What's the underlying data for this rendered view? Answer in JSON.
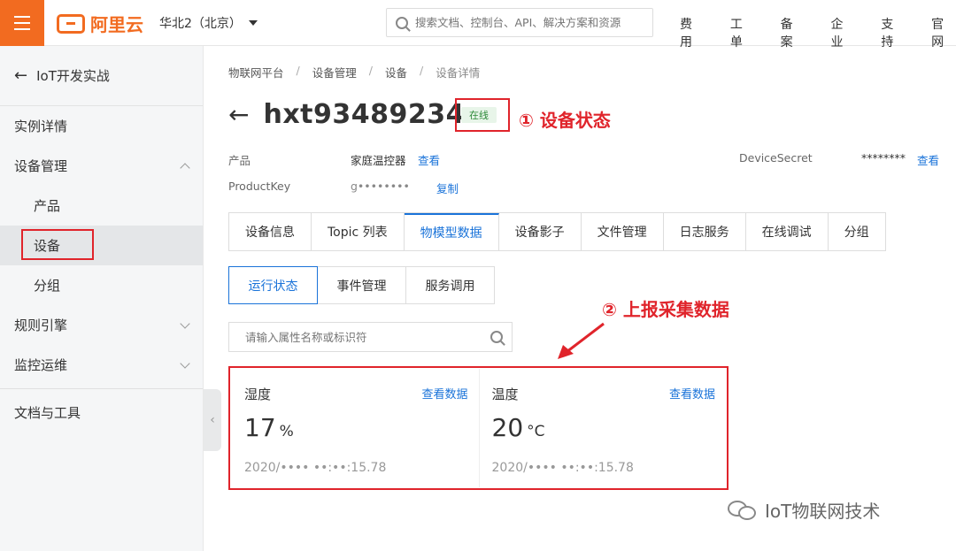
{
  "topbar": {
    "logo_text": "阿里云",
    "region": "华北2（北京）",
    "search_placeholder": "搜索文档、控制台、API、解决方案和资源",
    "nav": [
      "费用",
      "工单",
      "备案",
      "企业",
      "支持",
      "官网"
    ]
  },
  "sidebar": {
    "title": "IoT开发实战",
    "items": [
      {
        "label": "实例详情"
      },
      {
        "label": "设备管理"
      },
      {
        "label": "产品"
      },
      {
        "label": "设备"
      },
      {
        "label": "分组"
      },
      {
        "label": "规则引擎"
      },
      {
        "label": "监控运维"
      },
      {
        "label": "文档与工具"
      }
    ]
  },
  "breadcrumb": [
    "物联网平台",
    "设备管理",
    "设备",
    "设备详情"
  ],
  "device": {
    "name": "hxt93489234",
    "status": "在线",
    "product_label": "产品",
    "product_value": "家庭温控器",
    "product_link": "查看",
    "productkey_label": "ProductKey",
    "productkey_value": "g••••••••",
    "productkey_link": "复制",
    "secret_label": "DeviceSecret",
    "secret_value": "********",
    "secret_link": "查看"
  },
  "annotations": {
    "status": "① 设备状态",
    "data": "② 上报采集数据"
  },
  "tabs": [
    "设备信息",
    "Topic 列表",
    "物模型数据",
    "设备影子",
    "文件管理",
    "日志服务",
    "在线调试",
    "分组"
  ],
  "subtabs": [
    "运行状态",
    "事件管理",
    "服务调用"
  ],
  "prop_search_placeholder": "请输入属性名称或标识符",
  "cards": [
    {
      "label": "湿度",
      "link": "查看数据",
      "value": "17",
      "unit": "%",
      "time": "2020/•••• ••:••:15.78"
    },
    {
      "label": "温度",
      "link": "查看数据",
      "value": "20",
      "unit": "°C",
      "time": "2020/•••• ••:••:15.78"
    }
  ],
  "watermark": "IoT物联网技术",
  "colors": {
    "brand": "#f26b20",
    "link": "#1a73d9",
    "annotation": "#e0242b",
    "status_bg": "#e8f5e9"
  }
}
